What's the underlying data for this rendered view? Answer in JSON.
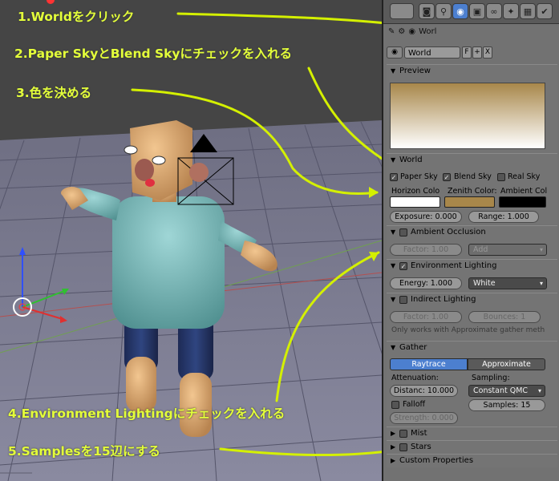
{
  "colors": {
    "accent": "#e4ff3a",
    "panel_bg": "#727272",
    "active_blue": "#4c7fcf"
  },
  "annotations": [
    "1.Worldをクリック",
    "2.Paper SkyとBlend Skyにチェックを入れる",
    "3.色を決める",
    "4.Environment Lightingにチェックを入れる",
    "5.Samplesを15辺にする"
  ],
  "context_tabs": [
    "render-icon",
    "scene-icon",
    "world-icon",
    "object-icon",
    "constraint-icon",
    "modifier-icon",
    "material-icon",
    "texture-icon"
  ],
  "breadcrumb": {
    "label": "Worl"
  },
  "world_block": {
    "name": "World",
    "fake_user": "F",
    "plus": "+",
    "close": "X"
  },
  "preview": {
    "title": "Preview"
  },
  "world": {
    "title": "World",
    "paper_sky": "Paper Sky",
    "blend_sky": "Blend Sky",
    "real_sky": "Real Sky",
    "horizon_label": "Horizon Colo",
    "zenith_label": "Zenith Color:",
    "ambient_label": "Ambient Col",
    "horizon_color": "#ffffff",
    "zenith_color": "#a8874a",
    "ambient_color": "#000000",
    "exposure": "Exposure: 0.000",
    "range": "Range: 1.000"
  },
  "ao": {
    "title": "Ambient Occlusion",
    "factor": "Factor: 1.00",
    "mode": "Add"
  },
  "env": {
    "title": "Environment Lighting",
    "energy": "Energy: 1.000",
    "mode": "White"
  },
  "indirect": {
    "title": "Indirect Lighting",
    "factor": "Factor: 1.00",
    "bounces": "Bounces: 1",
    "note": "Only works with Approximate gather meth"
  },
  "gather": {
    "title": "Gather",
    "tab_raytrace": "Raytrace",
    "tab_approx": "Approximate",
    "attenuation_label": "Attenuation:",
    "distance": "Distanc: 10.000",
    "sampling_label": "Sampling:",
    "sampling": "Constant QMC",
    "falloff": "Falloff",
    "samples": "Samples: 15",
    "strength": "Strength: 0.000"
  },
  "mist": {
    "title": "Mist"
  },
  "stars": {
    "title": "Stars"
  },
  "custom": {
    "title": "Custom Properties"
  }
}
